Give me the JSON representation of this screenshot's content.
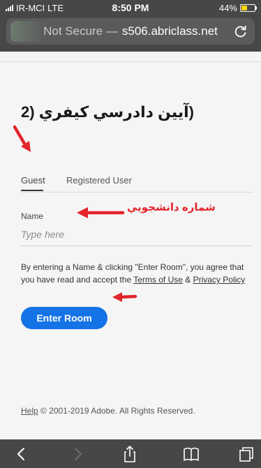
{
  "status_bar": {
    "carrier": "IR-MCI",
    "network": "LTE",
    "time": "8:50 PM",
    "battery": "44%",
    "battery_level": 0.44
  },
  "url_bar": {
    "security": "Not Secure —",
    "domain": "s506.abriclass.net"
  },
  "page": {
    "title": "(آيين دادرسي كيفري (2",
    "tabs": [
      {
        "label": "Guest",
        "active": true
      },
      {
        "label": "Registered User",
        "active": false
      }
    ],
    "name_label": "Name",
    "name_placeholder": "Type here",
    "terms_prefix": "By entering a Name & clicking \"Enter Room\", you agree that you have read and accept the ",
    "terms_link": "Terms of Use",
    "terms_and": " & ",
    "privacy_link": "Privacy Policy",
    "enter_button": "Enter Room",
    "footer_help": "Help",
    "footer_copyright": " © 2001-2019 Adobe. All Rights Reserved."
  },
  "annotations": {
    "student_number": "شماره دانشجويي"
  },
  "colors": {
    "accent": "#1473e6",
    "annotation": "#e3242b",
    "chrome": "#474747"
  }
}
